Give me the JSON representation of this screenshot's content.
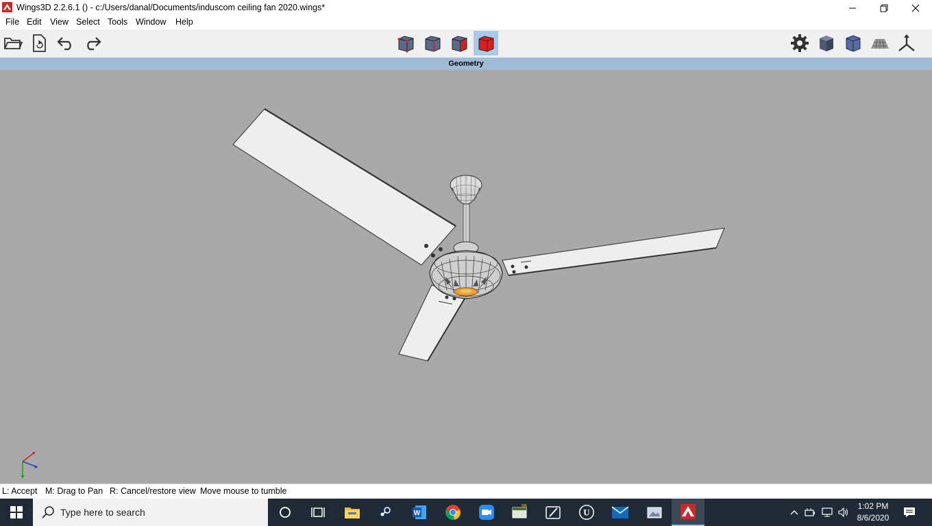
{
  "window": {
    "title": "Wings3D 2.2.6.1 () - c:/Users/danal/Documents/induscom ceiling fan 2020.wings*",
    "controls": {
      "minimize": "minimize-icon",
      "maximize": "restore-icon",
      "close": "close-icon"
    }
  },
  "menu": [
    "File",
    "Edit",
    "View",
    "Select",
    "Tools",
    "Window",
    "Help"
  ],
  "toolbar": {
    "file_icons": [
      "open-folder-icon",
      "save-icon",
      "undo-icon",
      "redo-icon"
    ],
    "selection_modes": [
      "vertex-mode-icon",
      "edge-mode-icon",
      "face-mode-icon",
      "body-mode-icon"
    ],
    "active_selection_mode": "body-mode-icon",
    "view_icons": [
      "settings-gear-icon",
      "smooth-shading-icon",
      "wireframe-cube-icon",
      "ground-grid-icon",
      "axes-icon"
    ]
  },
  "viewport": {
    "header": "Geometry",
    "background_color": "#a9a9a9",
    "axis_gizmo": "xyz-axes-icon"
  },
  "status": {
    "left_hint": "L: Accept",
    "middle_hint": "M: Drag to Pan",
    "right_hint": "R: Cancel/restore view",
    "message": "Move mouse to tumble"
  },
  "taskbar": {
    "search_placeholder": "Type here to search",
    "apps": [
      "cortana-icon",
      "task-view-icon",
      "file-explorer-icon",
      "steam-icon",
      "word-icon",
      "chrome-icon",
      "zoom-icon",
      "notes-icon",
      "pen-app-icon",
      "unreal-engine-icon",
      "mail-icon",
      "photos-icon",
      "wings3d-icon"
    ],
    "active_app": "wings3d-icon",
    "tray_icons": [
      "show-hidden-icon",
      "battery-icon",
      "network-icon",
      "volume-icon"
    ],
    "time": "1:02 PM",
    "date": "8/6/2020",
    "notification": "notification-icon"
  },
  "colors": {
    "active_tool": "#a9c9e8",
    "header_bar": "#9fbbd6",
    "taskbar": "#1f2a36"
  }
}
